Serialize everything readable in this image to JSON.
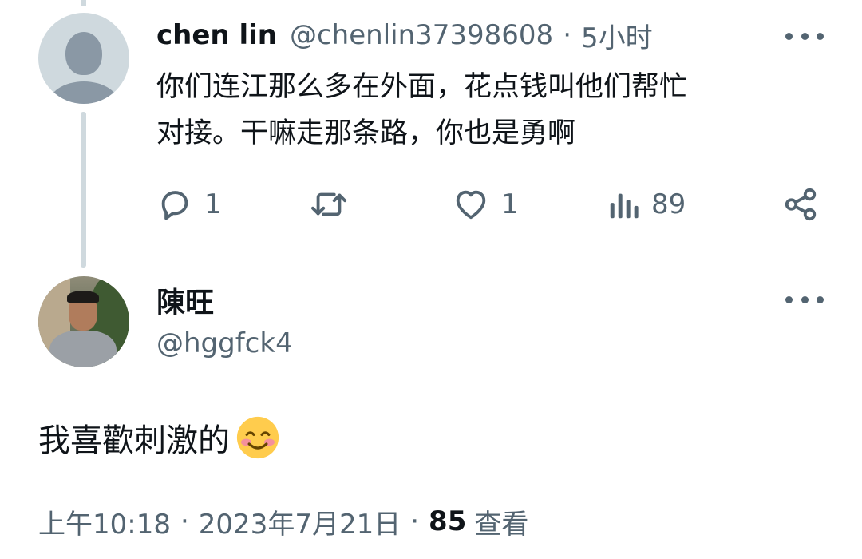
{
  "reply": {
    "name": "chen lin",
    "handle": "@chenlin37398608",
    "separator": "·",
    "time": "5小时",
    "text_lines": [
      "你们连江那么多在外面，花点钱叫他们帮忙",
      "对接。干嘛走那条路，你也是勇啊"
    ],
    "actions": {
      "reply_count": "1",
      "retweet_count": "",
      "like_count": "1",
      "views_count": "89"
    },
    "icons": [
      "reply-icon",
      "retweet-icon",
      "like-icon",
      "views-icon",
      "share-icon",
      "more-icon"
    ]
  },
  "main": {
    "name": "陳旺",
    "handle": "@hggfck4",
    "text": "我喜歡刺激的",
    "emoji": "smiling-face-with-smiling-eyes",
    "meta": {
      "time": "上午10:18",
      "separator": "·",
      "date": "2023年7月21日",
      "views_count": "85",
      "views_label": "查看"
    }
  },
  "colors": {
    "text_primary": "#0f1419",
    "text_secondary": "#536471",
    "thread_line": "#cfd9de",
    "background": "#ffffff"
  }
}
